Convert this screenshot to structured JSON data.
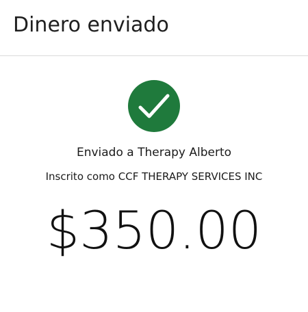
{
  "header": {
    "title": "Dinero enviado"
  },
  "status": {
    "icon": "checkmark-icon",
    "color": "#1f7a3c"
  },
  "recipient": {
    "sent_to": "Enviado a Therapy Alberto",
    "registered_as": "Inscrito como CCF THERAPY SERVICES INC"
  },
  "payment": {
    "amount": "$350.00"
  }
}
